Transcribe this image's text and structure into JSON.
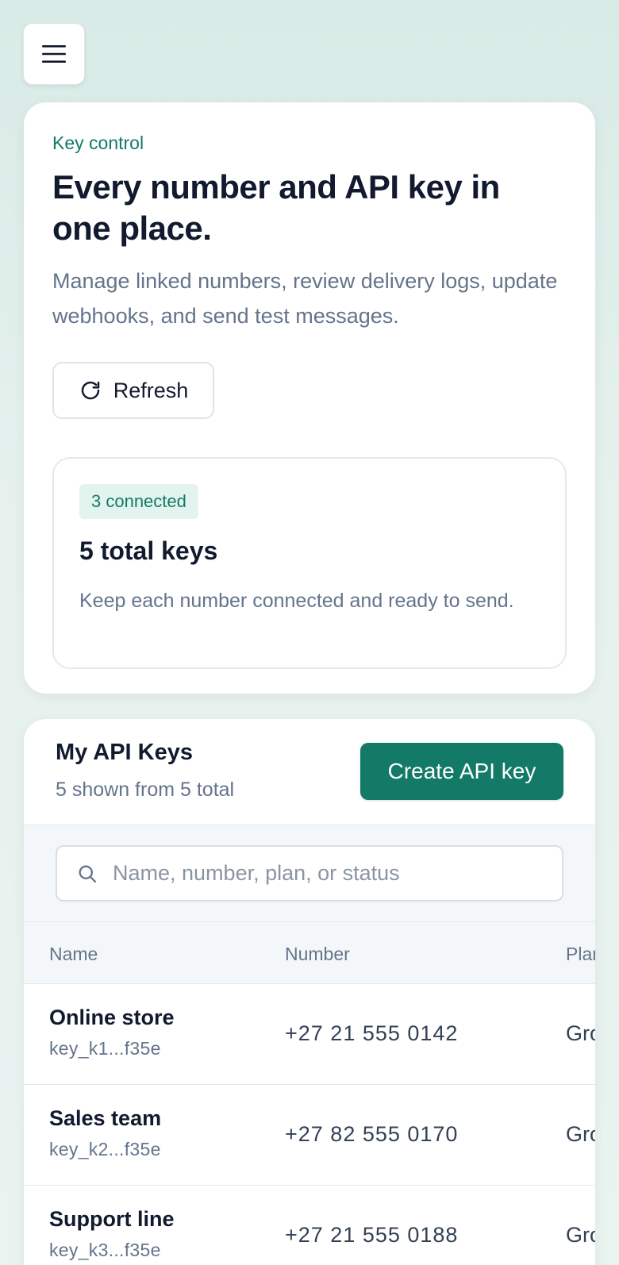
{
  "menu": {
    "icon": "hamburger-icon"
  },
  "hero": {
    "eyebrow": "Key control",
    "title": "Every number and API key in one place.",
    "description": "Manage linked numbers, review delivery logs, update webhooks, and send test messages.",
    "refresh_label": "Refresh",
    "refresh_icon": "refresh-icon"
  },
  "stats": {
    "badge": "3 connected",
    "title": "5 total keys",
    "description": "Keep each number connected and ready to send."
  },
  "keys": {
    "title": "My API Keys",
    "subtitle": "5 shown from 5 total",
    "create_label": "Create API key",
    "search_placeholder": "Name, number, plan, or status",
    "search_value": "",
    "columns": {
      "name": "Name",
      "number": "Number",
      "plan": "Plan"
    },
    "rows": [
      {
        "name": "Online store",
        "key": "key_k1...f35e",
        "number": "+27 21 555 0142",
        "plan": "Growth"
      },
      {
        "name": "Sales team",
        "key": "key_k2...f35e",
        "number": "+27 82 555 0170",
        "plan": "Growth"
      },
      {
        "name": "Support line",
        "key": "key_k3...f35e",
        "number": "+27 21 555 0188",
        "plan": "Growth"
      }
    ]
  },
  "colors": {
    "accent": "#137a67",
    "badge_bg": "#e3f4ee",
    "heading": "#111a2e",
    "muted": "#64748b",
    "page_bg": "#dcece8"
  }
}
